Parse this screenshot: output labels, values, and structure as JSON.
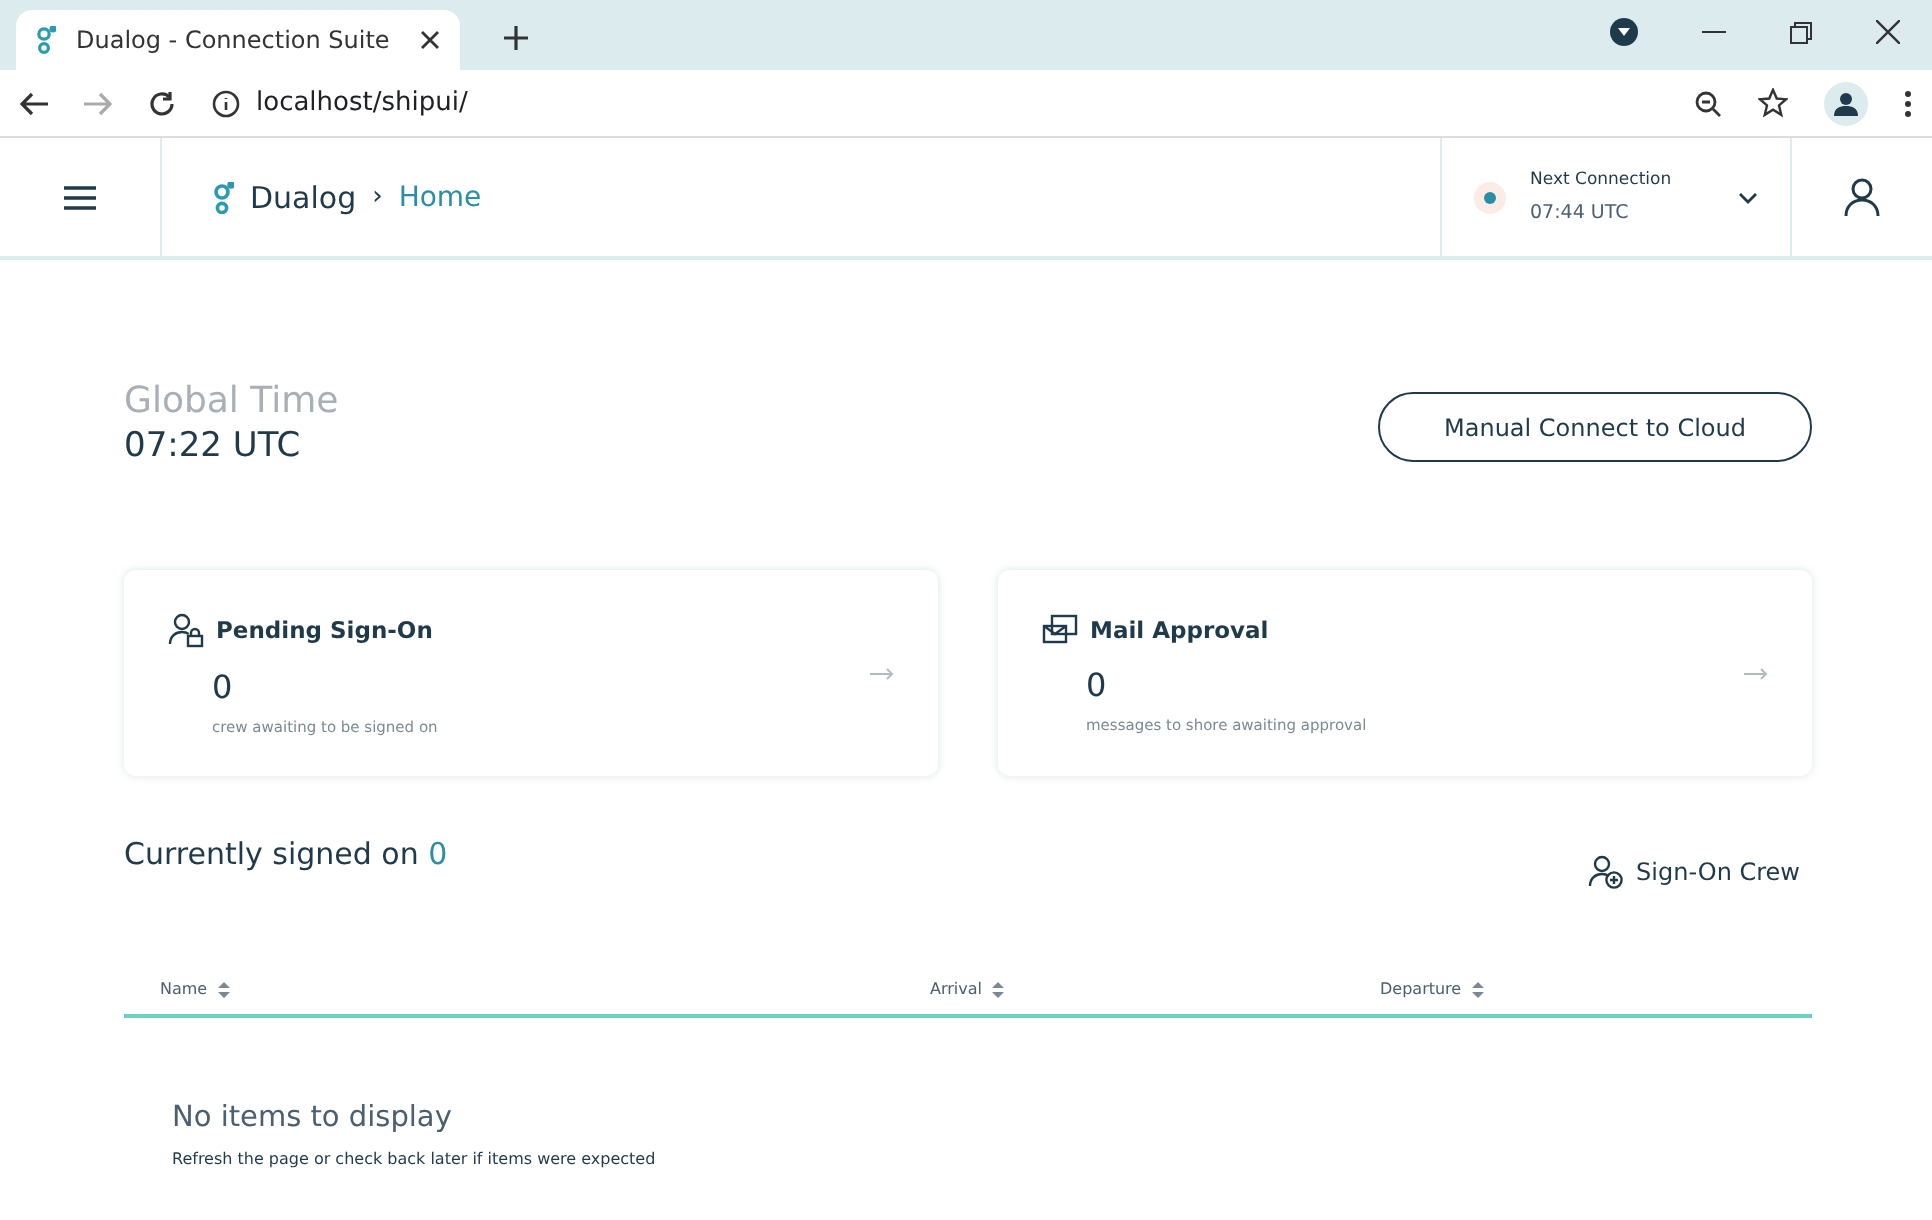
{
  "browser": {
    "tab_title": "Dualog - Connection Suite",
    "address": "localhost/shipui/"
  },
  "header": {
    "brand": "Dualog",
    "separator": "›",
    "page": "Home",
    "next_connection": {
      "label": "Next Connection",
      "time": "07:44 UTC"
    }
  },
  "global_time": {
    "label": "Global Time",
    "time": "07:22 UTC"
  },
  "cloud_button": "Manual Connect to Cloud",
  "cards": [
    {
      "kind": "crew",
      "title": "Pending Sign-On",
      "count": "0",
      "caption": "crew awaiting to be signed on"
    },
    {
      "kind": "mail",
      "title": "Mail Approval",
      "count": "0",
      "caption": "messages to shore awaiting approval"
    }
  ],
  "signed_on": {
    "title": "Currently signed on",
    "count": "0",
    "action": "Sign-On Crew"
  },
  "table": {
    "columns": [
      "Name",
      "Arrival",
      "Departure"
    ],
    "empty_title": "No items to display",
    "empty_hint": "Refresh the page or check back later if items were expected"
  }
}
